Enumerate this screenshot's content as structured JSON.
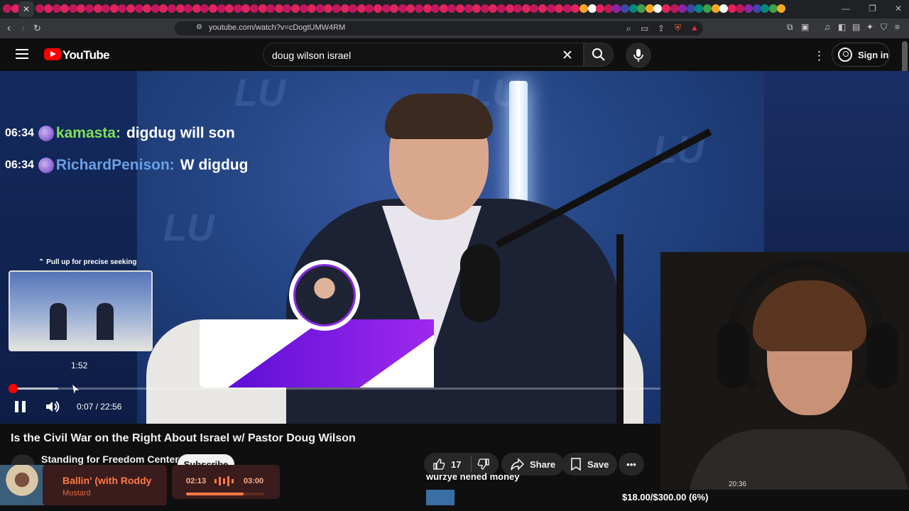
{
  "browser": {
    "url": "youtube.com/watch?v=cDogtUMW4RM"
  },
  "youtube": {
    "logo_text": "YouTube",
    "search_value": "doug wilson israel",
    "sign_in_label": "Sign in"
  },
  "video": {
    "chat": [
      {
        "time": "06:34",
        "user": "kamasta:",
        "message": "digdug will son",
        "user_color": "#7ee05a"
      },
      {
        "time": "06:34",
        "user": "RichardPenison:",
        "message": "W digdug",
        "user_color": "#6aa0e6"
      }
    ],
    "seek_hint": "Pull up for precise seeking",
    "preview_time": "1:52",
    "current_time": "0:07",
    "duration": "22:56",
    "time_display": "0:07 / 22:56",
    "played_fraction": 0.005,
    "hover_fraction": 0.069
  },
  "details": {
    "title": "Is the Civil War on the Right About Israel w/ Pastor Doug Wilson",
    "channel": "Standing for Freedom Center",
    "subscribe_label": "Subscribe",
    "likes": "17",
    "share_label": "Share",
    "save_label": "Save"
  },
  "overlay": {
    "donation_text": "wurzye nened money",
    "goal_text": "$18.00/$300.00 (6%)",
    "goal_fraction": 0.06,
    "music": {
      "title": "Ballin' (with Roddy",
      "artist": "Mustard",
      "current": "02:13",
      "total": "03:00",
      "progress_fraction": 0.74
    },
    "facecam_time": "20:36"
  },
  "colors": {
    "accent": "#ff0000",
    "background": "#0f0f0f",
    "music_accent": "#ff7a45"
  }
}
